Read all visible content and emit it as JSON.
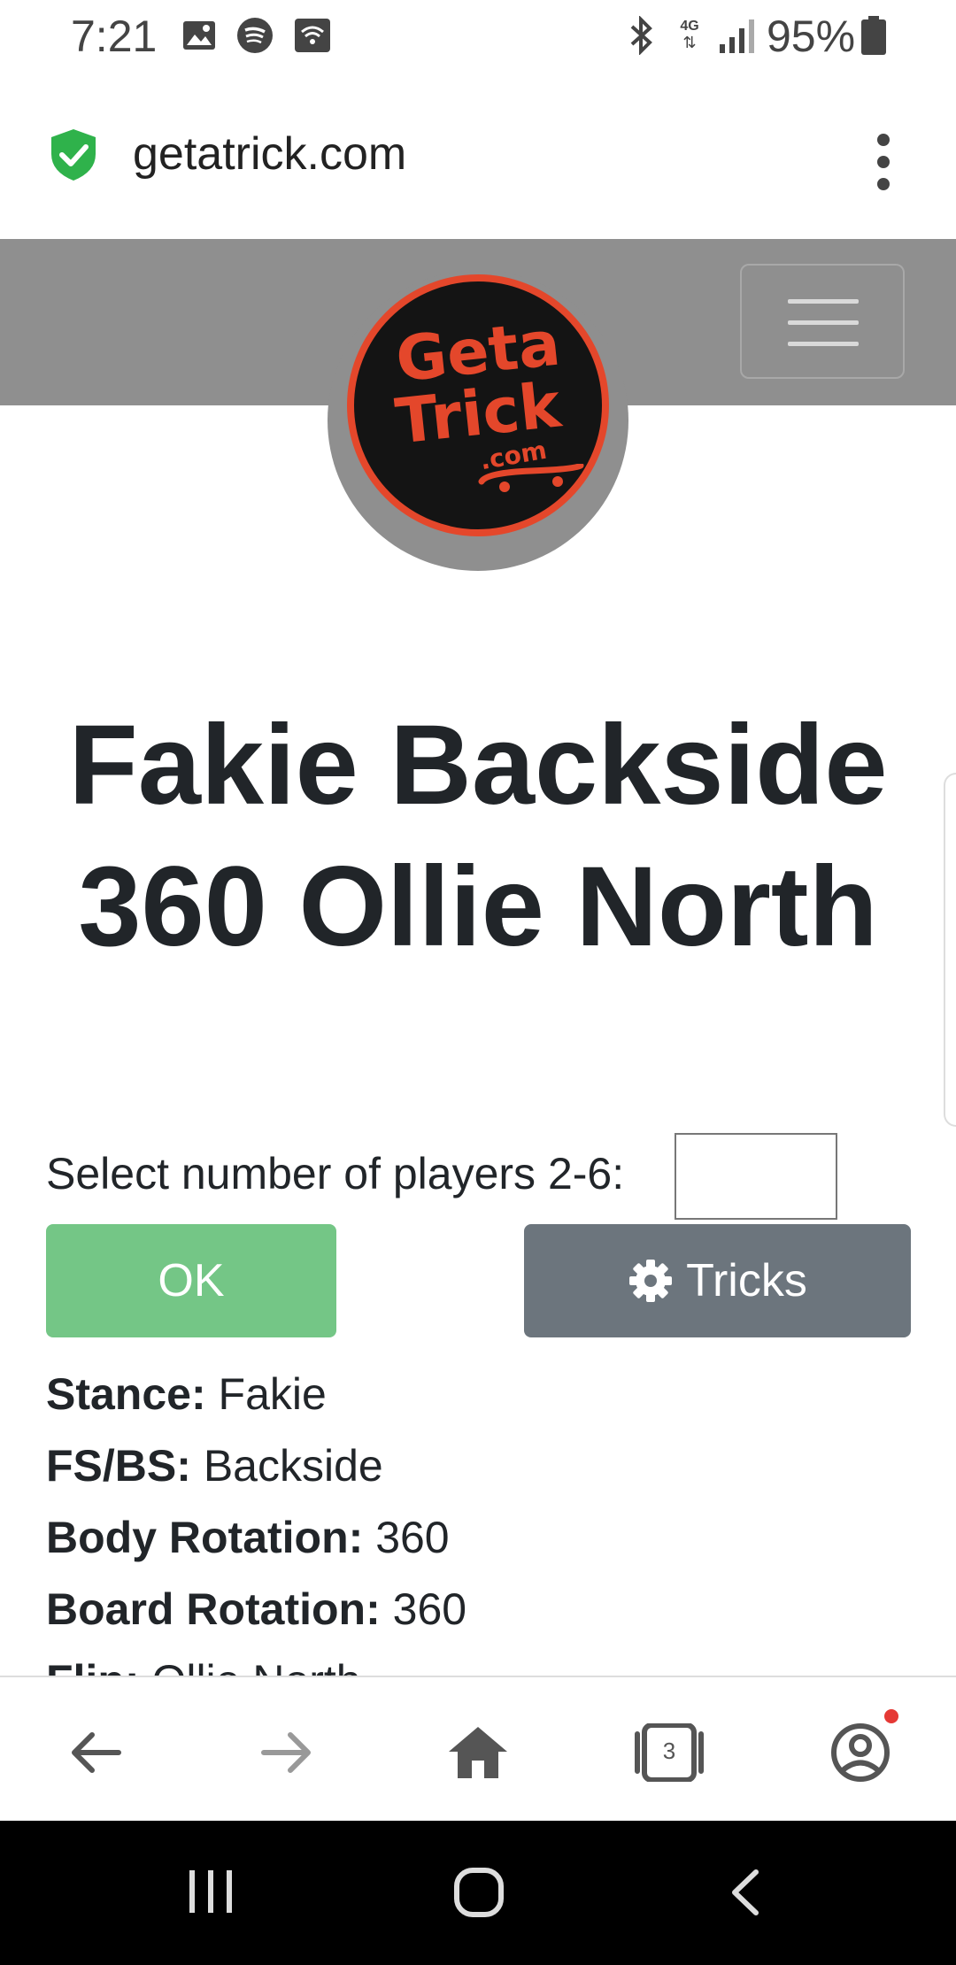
{
  "status_bar": {
    "time": "7:21",
    "battery": "95%",
    "network": "4G"
  },
  "browser": {
    "url": "getatrick.com"
  },
  "site": {
    "logo_text_line1": "Geta",
    "logo_text_line2": "Trick",
    "logo_text_line3": ".com"
  },
  "trick": {
    "title_line1": "Fakie Backside",
    "title_line2": "360 Ollie North"
  },
  "players": {
    "label": "Select number of players 2-6:",
    "value": ""
  },
  "buttons": {
    "ok": "OK",
    "tricks": "Tricks"
  },
  "details": [
    {
      "label": "Stance:",
      "value": "Fakie"
    },
    {
      "label": "FS/BS:",
      "value": "Backside"
    },
    {
      "label": "Body Rotation:",
      "value": "360"
    },
    {
      "label": "Board Rotation:",
      "value": "360"
    },
    {
      "label": "Flip:",
      "value": "Ollie North"
    }
  ],
  "bottom_nav": {
    "tabs_count": "3"
  },
  "colors": {
    "header_gray": "#8f8f8f",
    "logo_red": "#e4472b",
    "ok_green": "#74c686",
    "tricks_gray": "#6c757d",
    "shield_green": "#2fb24b"
  }
}
